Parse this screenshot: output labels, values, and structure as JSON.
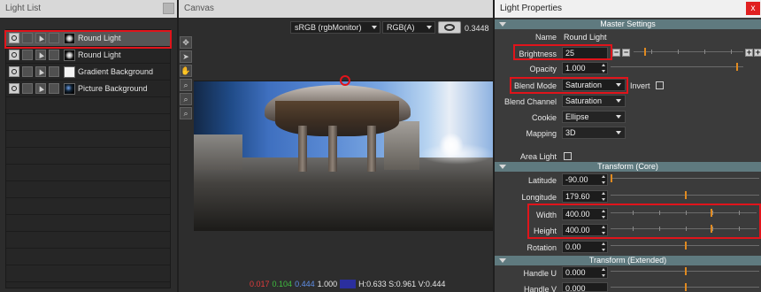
{
  "light_list": {
    "title": "Light List",
    "items": [
      {
        "label": "Round Light",
        "thumb": "round-light"
      },
      {
        "label": "Round Light",
        "thumb": "round-light"
      },
      {
        "label": "Gradient Background",
        "thumb": "gradient"
      },
      {
        "label": "Picture Background",
        "thumb": "picture"
      }
    ],
    "selected_index": 0
  },
  "canvas": {
    "title": "Canvas",
    "colorspace": "sRGB (rgbMonitor)",
    "channel": "RGB(A)",
    "exposure": "0.3448",
    "tools": [
      "move-tool-icon",
      "select-arrow-icon",
      "hand-pan-icon",
      "zoom-icon",
      "zoom-in-icon",
      "zoom-out-icon"
    ],
    "pixel_info": {
      "r": "0.017",
      "g": "0.104",
      "b": "0.444",
      "a": "1.000",
      "hsv": "H:0.633 S:0.961 V:0.444"
    }
  },
  "properties": {
    "title": "Light Properties",
    "close": "x",
    "sections": {
      "master": "Master Settings",
      "transform_core": "Transform (Core)",
      "transform_ext": "Transform (Extended)"
    },
    "labels": {
      "name": "Name",
      "brightness": "Brightness",
      "opacity": "Opacity",
      "blend_mode": "Blend Mode",
      "invert": "Invert",
      "blend_channel": "Blend Channel",
      "cookie": "Cookie",
      "mapping": "Mapping",
      "area_light": "Area Light",
      "latitude": "Latitude",
      "longitude": "Longitude",
      "width": "Width",
      "height": "Height",
      "rotation": "Rotation",
      "handle_u": "Handle U",
      "handle_v": "Handle V"
    },
    "values": {
      "name": "Round Light",
      "brightness": "25",
      "opacity": "1.000",
      "blend_mode": "Saturation",
      "blend_channel": "Saturation",
      "cookie": "Ellipse",
      "mapping": "3D",
      "latitude": "-90.00",
      "longitude": "179.60",
      "width": "400.00",
      "height": "400.00",
      "rotation": "0.00",
      "handle_u": "0.000",
      "handle_v": "0.000"
    },
    "buttons": {
      "minus": "−",
      "plus": "+"
    }
  },
  "colors": {
    "highlight_red": "#e0141b",
    "section_header": "#5f7a7f",
    "slider_thumb": "#e08a20",
    "selected_row": "#565656"
  }
}
